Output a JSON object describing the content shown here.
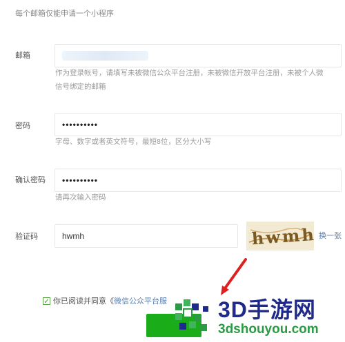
{
  "notice": "每个邮箱仅能申请一个小程序",
  "form": {
    "email": {
      "label": "邮箱",
      "help_line1": "作为登录帐号，请填写未被微信公众平台注册，未被微信开放平台注册，未被个人微",
      "help_line2": "信号绑定的邮箱"
    },
    "password": {
      "label": "密码",
      "value": "••••••••••",
      "help": "字母、数字或者英文符号，最短8位，区分大小写"
    },
    "confirm_password": {
      "label": "确认密码",
      "value": "••••••••••",
      "help": "请再次输入密码"
    },
    "captcha": {
      "label": "验证码",
      "value": "hwmh",
      "image_text": "hwmh",
      "change_label": "换一张"
    }
  },
  "agreement": {
    "text": "你已阅读并同意《",
    "link": "微信公众平台服"
  },
  "watermark": {
    "name": "3D手游网",
    "url": "3dshouyou.com"
  },
  "colors": {
    "accent_green": "#1aad19",
    "link_blue": "#5a7fb0",
    "arrow_red": "#e02020"
  }
}
